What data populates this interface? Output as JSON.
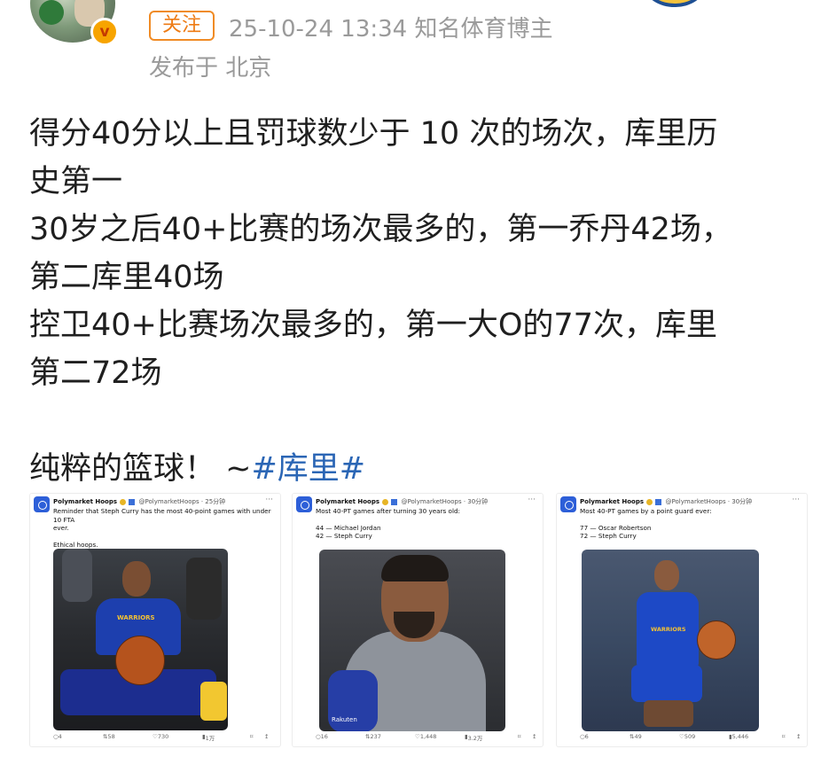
{
  "post": {
    "follow_label": "关注",
    "time_and_author": "25-10-24 13:34  知名体育博主",
    "location": "发布于 北京",
    "lines": [
      "得分40分以上且罚球数少于 10 次的场次，库里历",
      "史第一",
      "30岁之后40+比赛的场次最多的，第一乔丹42场，",
      "第二库里40场",
      "控卫40+比赛场次最多的，第一大O的77次，库里",
      "第二72场"
    ],
    "closing_prefix": "纯粹的篮球！ ~",
    "hashtag": "#库里#"
  },
  "tweets": [
    {
      "name": "Polymarket Hoops",
      "handle": "@PolymarketHoops · 25分钟",
      "text_lines": [
        "Reminder that Steph Curry has the most 40-point games with under 10 FTA",
        "ever."
      ],
      "extra_line": "Ethical hoops.",
      "photo_text": "WARRIORS",
      "replies": "4",
      "retweets": "58",
      "likes": "730",
      "views": "1万"
    },
    {
      "name": "Polymarket Hoops",
      "handle": "@PolymarketHoops · 30分钟",
      "text_lines": [
        "Most 40-PT games after turning 30 years old:"
      ],
      "list": [
        "44 — Michael Jordan",
        "42 — Steph Curry"
      ],
      "photo_text": "Rakuten",
      "replies": "16",
      "retweets": "237",
      "likes": "1,448",
      "views": "3.2万"
    },
    {
      "name": "Polymarket Hoops",
      "handle": "@PolymarketHoops · 30分钟",
      "text_lines": [
        "Most 40-PT games by a point guard ever:"
      ],
      "list": [
        "77 — Oscar Robertson",
        "72 — Steph Curry"
      ],
      "photo_text": "WARRIORS",
      "replies": "6",
      "retweets": "49",
      "likes": "509",
      "views": "5,446"
    }
  ],
  "icons": {
    "verified": "v-badge-icon",
    "more": "more-dots-icon",
    "reply": "reply-icon",
    "retweet": "retweet-icon",
    "like": "heart-icon",
    "views": "views-icon",
    "bookmark": "bookmark-icon",
    "share": "share-icon"
  },
  "colors": {
    "follow": "#ee7b14",
    "hashtag": "#2b66b5",
    "meta": "#9a9a9a",
    "verified": "#f7a400"
  }
}
